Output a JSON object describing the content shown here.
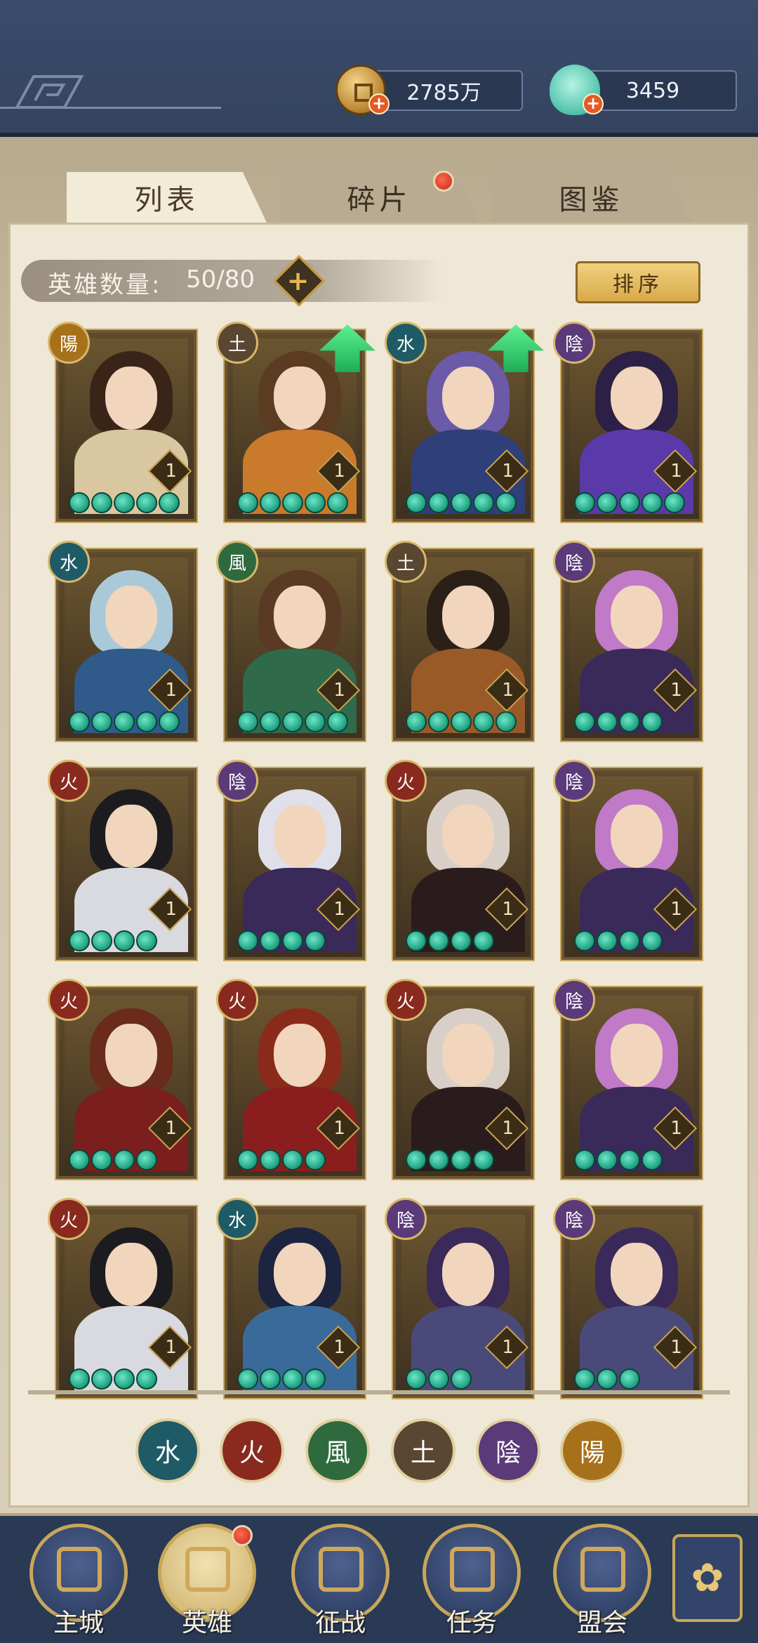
{
  "currency": {
    "coins": "2785万",
    "shells": "3459"
  },
  "tabs": [
    {
      "label": "列表",
      "active": true
    },
    {
      "label": "碎片",
      "active": false,
      "has_notification": true
    },
    {
      "label": "图鉴",
      "active": false
    }
  ],
  "hero_count": {
    "label": "英雄数量:",
    "value": "50/80"
  },
  "sort_button": "排序",
  "elements": {
    "water": {
      "glyph": "水",
      "color": "#1e5b66"
    },
    "fire": {
      "glyph": "火",
      "color": "#8a2a1f"
    },
    "wind": {
      "glyph": "風",
      "color": "#2f6a3e"
    },
    "earth": {
      "glyph": "土",
      "color": "#5a4731"
    },
    "yin": {
      "glyph": "陰",
      "color": "#5b3a7a"
    },
    "yang": {
      "glyph": "陽",
      "color": "#a7711c"
    }
  },
  "heroes": [
    {
      "element": "yang",
      "level": "1",
      "stars": 5,
      "upgrade": false,
      "hair": "#3a2418",
      "outfit": "#d9c7a0"
    },
    {
      "element": "earth",
      "level": "1",
      "stars": 5,
      "upgrade": true,
      "hair": "#5c3b23",
      "outfit": "#c97a2a"
    },
    {
      "element": "water",
      "level": "1",
      "stars": 5,
      "upgrade": true,
      "hair": "#6a5aa8",
      "outfit": "#2f3f7a"
    },
    {
      "element": "yin",
      "level": "1",
      "stars": 5,
      "upgrade": false,
      "hair": "#2c2046",
      "outfit": "#5a3aa8"
    },
    {
      "element": "water",
      "level": "1",
      "stars": 5,
      "upgrade": false,
      "hair": "#a9c9d8",
      "outfit": "#2f5a8a"
    },
    {
      "element": "wind",
      "level": "1",
      "stars": 5,
      "upgrade": false,
      "hair": "#5a3a24",
      "outfit": "#2f6a4a"
    },
    {
      "element": "earth",
      "level": "1",
      "stars": 5,
      "upgrade": false,
      "hair": "#2a2018",
      "outfit": "#9a5a28"
    },
    {
      "element": "yin",
      "level": "1",
      "stars": 4,
      "upgrade": false,
      "hair": "#c07ac8",
      "outfit": "#3a2a5a"
    },
    {
      "element": "fire",
      "level": "1",
      "stars": 4,
      "upgrade": false,
      "hair": "#1c1c20",
      "outfit": "#d9d9e0"
    },
    {
      "element": "yin",
      "level": "1",
      "stars": 4,
      "upgrade": false,
      "hair": "#e0e0ea",
      "outfit": "#3a2a5a"
    },
    {
      "element": "fire",
      "level": "1",
      "stars": 4,
      "upgrade": false,
      "hair": "#d8d0c8",
      "outfit": "#2a1c1c"
    },
    {
      "element": "yin",
      "level": "1",
      "stars": 4,
      "upgrade": false,
      "hair": "#c07ac8",
      "outfit": "#3a2a5a"
    },
    {
      "element": "fire",
      "level": "1",
      "stars": 4,
      "upgrade": false,
      "hair": "#6a2a1c",
      "outfit": "#7a1e1e"
    },
    {
      "element": "fire",
      "level": "1",
      "stars": 4,
      "upgrade": false,
      "hair": "#8a2a1a",
      "outfit": "#8a1e1e"
    },
    {
      "element": "fire",
      "level": "1",
      "stars": 4,
      "upgrade": false,
      "hair": "#d8d0c8",
      "outfit": "#2a1c1c"
    },
    {
      "element": "yin",
      "level": "1",
      "stars": 4,
      "upgrade": false,
      "hair": "#c07ac8",
      "outfit": "#3a2a5a"
    },
    {
      "element": "fire",
      "level": "1",
      "stars": 4,
      "upgrade": false,
      "hair": "#1c1c20",
      "outfit": "#d9d9e0"
    },
    {
      "element": "water",
      "level": "1",
      "stars": 4,
      "upgrade": false,
      "hair": "#1c2440",
      "outfit": "#3a6a9a"
    },
    {
      "element": "yin",
      "level": "1",
      "stars": 3,
      "upgrade": false,
      "hair": "#3a2a5a",
      "outfit": "#4a4a7a"
    },
    {
      "element": "yin",
      "level": "1",
      "stars": 3,
      "upgrade": false,
      "hair": "#3a2a5a",
      "outfit": "#4a4a7a"
    }
  ],
  "element_filters": [
    "water",
    "fire",
    "wind",
    "earth",
    "yin",
    "yang"
  ],
  "nav": [
    {
      "label": "主城",
      "active": false
    },
    {
      "label": "英雄",
      "active": true,
      "has_notification": true
    },
    {
      "label": "征战",
      "active": false
    },
    {
      "label": "任务",
      "active": false
    },
    {
      "label": "盟会",
      "active": false
    }
  ]
}
